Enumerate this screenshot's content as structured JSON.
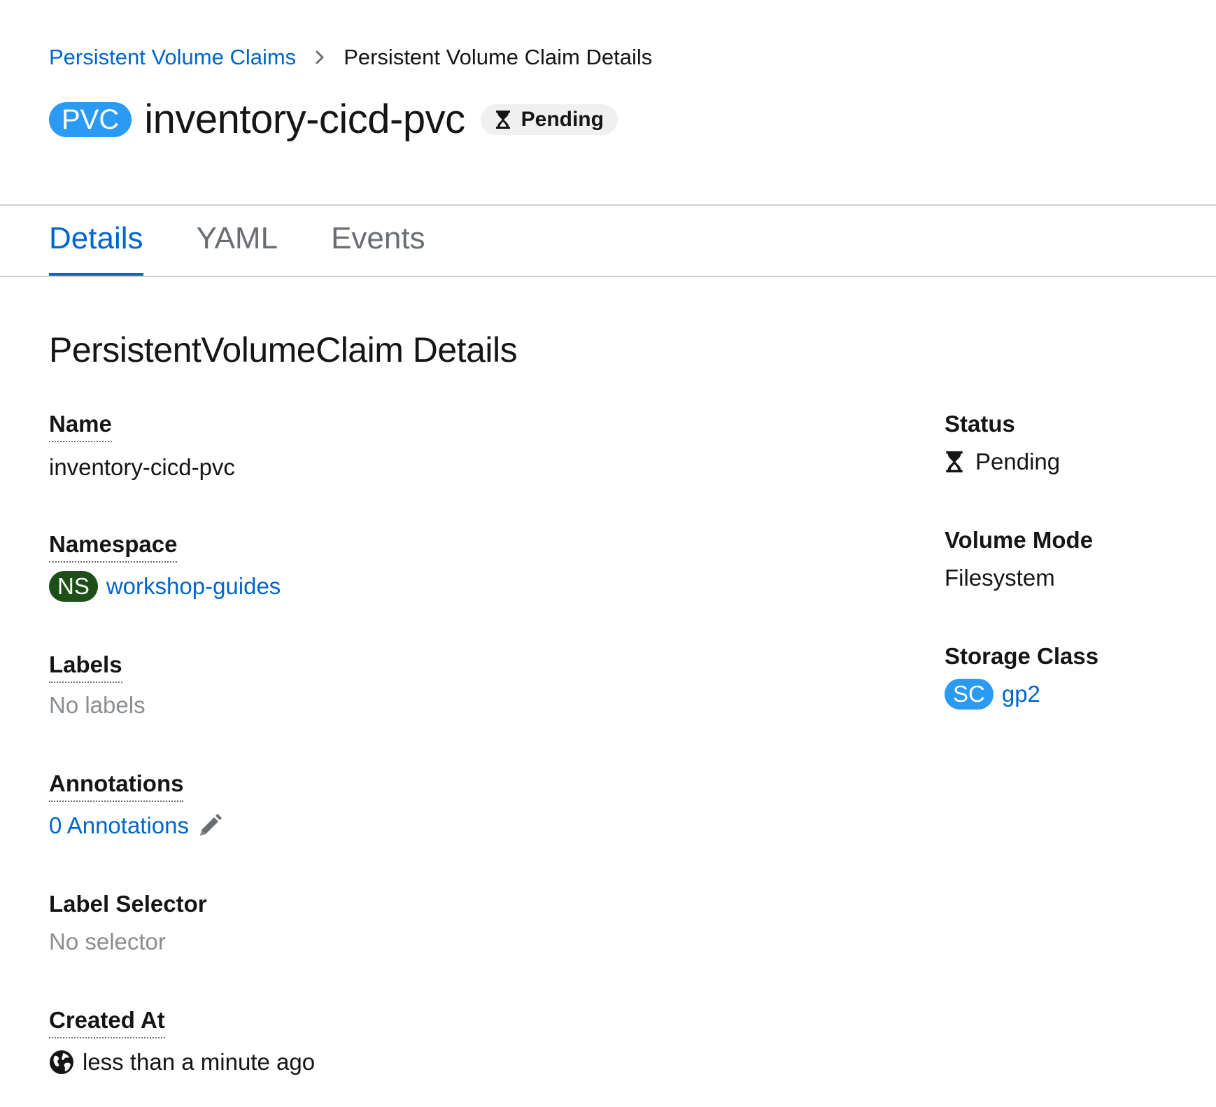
{
  "breadcrumb": {
    "parent": "Persistent Volume Claims",
    "current": "Persistent Volume Claim Details"
  },
  "header": {
    "badge": "PVC",
    "title": "inventory-cicd-pvc",
    "status": "Pending"
  },
  "tabs": [
    {
      "label": "Details",
      "active": true
    },
    {
      "label": "YAML",
      "active": false
    },
    {
      "label": "Events",
      "active": false
    }
  ],
  "section": {
    "title": "PersistentVolumeClaim Details"
  },
  "left": {
    "name": {
      "label": "Name",
      "value": "inventory-cicd-pvc"
    },
    "namespace": {
      "label": "Namespace",
      "badge": "NS",
      "value": "workshop-guides"
    },
    "labels": {
      "label": "Labels",
      "value": "No labels"
    },
    "annotations": {
      "label": "Annotations",
      "value": "0 Annotations"
    },
    "label_selector": {
      "label": "Label Selector",
      "value": "No selector"
    },
    "created_at": {
      "label": "Created At",
      "value": "less than a minute ago"
    }
  },
  "right": {
    "status": {
      "label": "Status",
      "value": "Pending"
    },
    "volume_mode": {
      "label": "Volume Mode",
      "value": "Filesystem"
    },
    "storage_class": {
      "label": "Storage Class",
      "badge": "SC",
      "value": "gp2"
    }
  },
  "icons": {
    "breadcrumb_separator": "chevron-right-icon",
    "status": "hourglass-icon",
    "edit": "pencil-icon",
    "timestamp": "globe-icon"
  },
  "colors": {
    "link": "#0066cc",
    "pvc_badge": "#2b9af3",
    "ns_badge": "#1e4f18",
    "sc_badge": "#2b9af3",
    "muted_text": "#8a8d90"
  }
}
